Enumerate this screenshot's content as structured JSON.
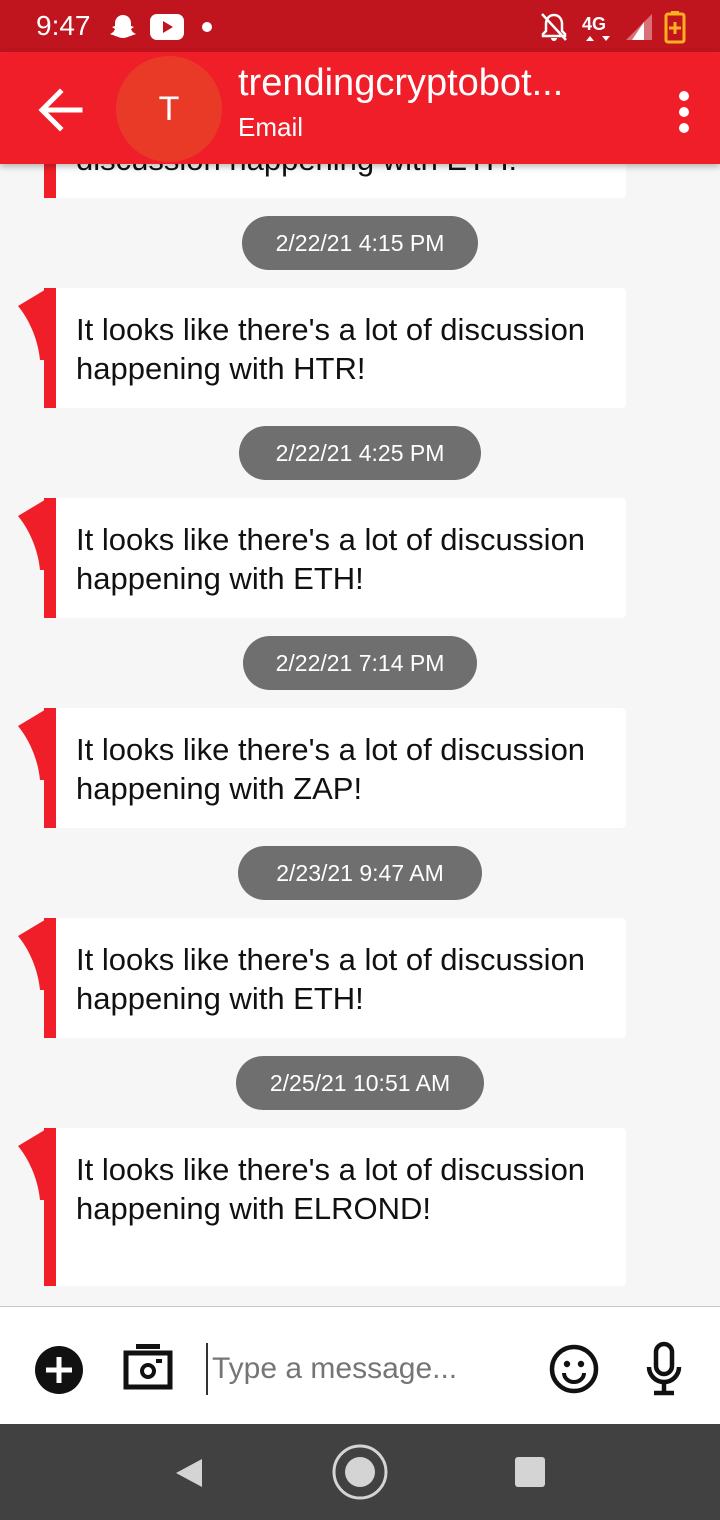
{
  "status_bar": {
    "time": "9:47",
    "icons": [
      "snapchat-icon",
      "youtube-icon",
      "dot-icon",
      "mute-icon",
      "4g-lte-icon",
      "signal-icon",
      "battery-icon"
    ],
    "network": "4G"
  },
  "header": {
    "avatar_letter": "T",
    "title": "trendingcryptobot...",
    "subtitle": "Email"
  },
  "conversation": {
    "partial_text": "discussion happening with ETH!",
    "items": [
      {
        "timestamp": "2/22/21 4:15 PM",
        "message": "It looks like there's a lot of discussion happening with HTR!"
      },
      {
        "timestamp": "2/22/21 4:25 PM",
        "message": "It looks like there's a lot of discussion happening with ETH!"
      },
      {
        "timestamp": "2/22/21 7:14 PM",
        "message": "It looks like there's a lot of discussion happening with ZAP!"
      },
      {
        "timestamp": "2/23/21 9:47 AM",
        "message": "It looks like there's a lot of discussion happening with ETH!"
      },
      {
        "timestamp": "2/25/21 10:51 AM",
        "message": "It looks like there's a lot of discussion happening with ELROND!"
      }
    ]
  },
  "compose": {
    "placeholder": "Type a message..."
  },
  "colors": {
    "status_bar": "#c0141e",
    "app_bar": "#ef1e28",
    "accent": "#ef1e28",
    "timestamp_pill": "#6f6f6f",
    "background": "#f6f6f6",
    "nav_bar": "#414141"
  }
}
